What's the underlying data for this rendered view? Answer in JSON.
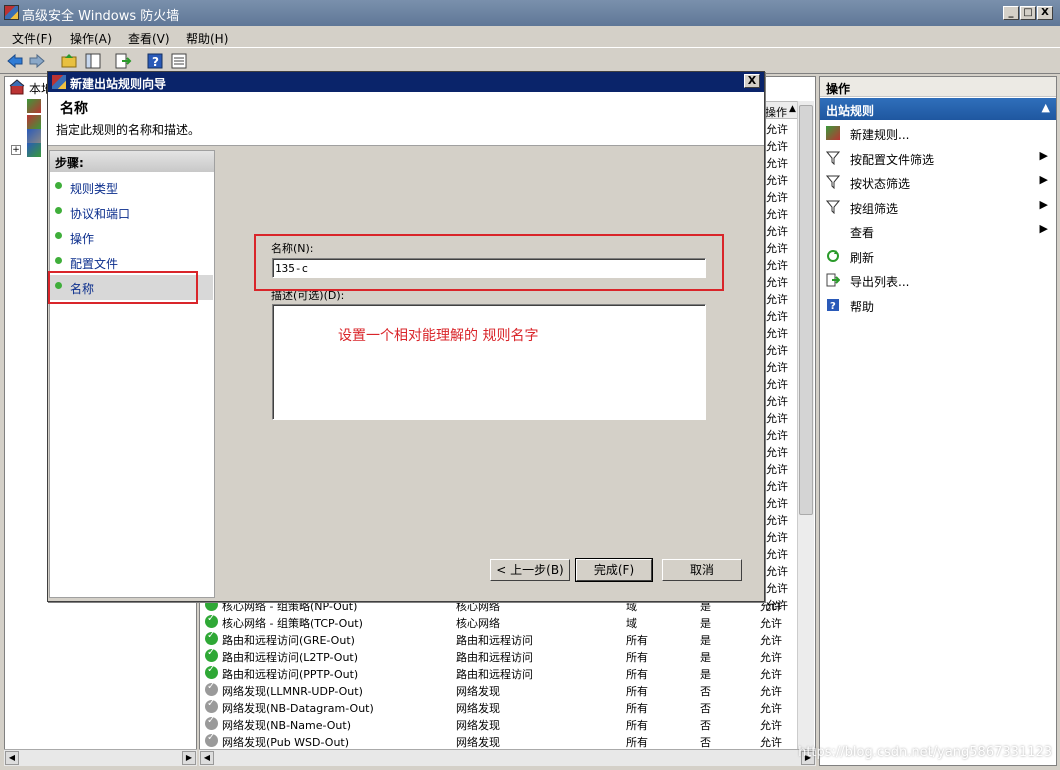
{
  "window": {
    "title": "高级安全 Windows 防火墙",
    "btn_min": "_",
    "btn_max": "□",
    "btn_close": "X"
  },
  "menu": [
    "文件(F)",
    "操作(A)",
    "查看(V)",
    "帮助(H)"
  ],
  "tree": {
    "root": "本地",
    "expand": "+"
  },
  "list": {
    "header_action": "操作",
    "partial_value": "允许",
    "rows": [
      {
        "name": "核心网络 - 组策略(NP-Out)",
        "group": "核心网络",
        "profile": "域",
        "enabled": "是",
        "action": "允许",
        "on": true
      },
      {
        "name": "核心网络 - 组策略(TCP-Out)",
        "group": "核心网络",
        "profile": "域",
        "enabled": "是",
        "action": "允许",
        "on": true
      },
      {
        "name": "路由和远程访问(GRE-Out)",
        "group": "路由和远程访问",
        "profile": "所有",
        "enabled": "是",
        "action": "允许",
        "on": true
      },
      {
        "name": "路由和远程访问(L2TP-Out)",
        "group": "路由和远程访问",
        "profile": "所有",
        "enabled": "是",
        "action": "允许",
        "on": true
      },
      {
        "name": "路由和远程访问(PPTP-Out)",
        "group": "路由和远程访问",
        "profile": "所有",
        "enabled": "是",
        "action": "允许",
        "on": true
      },
      {
        "name": "网络发现(LLMNR-UDP-Out)",
        "group": "网络发现",
        "profile": "所有",
        "enabled": "否",
        "action": "允许",
        "on": false
      },
      {
        "name": "网络发现(NB-Datagram-Out)",
        "group": "网络发现",
        "profile": "所有",
        "enabled": "否",
        "action": "允许",
        "on": false
      },
      {
        "name": "网络发现(NB-Name-Out)",
        "group": "网络发现",
        "profile": "所有",
        "enabled": "否",
        "action": "允许",
        "on": false
      },
      {
        "name": "网络发现(Pub WSD-Out)",
        "group": "网络发现",
        "profile": "所有",
        "enabled": "否",
        "action": "允许",
        "on": false
      }
    ]
  },
  "actions": {
    "header": "操作",
    "section": "出站规则",
    "items": [
      {
        "label": "新建规则...",
        "icon": "new-rule-icon",
        "sub": false
      },
      {
        "label": "按配置文件筛选",
        "icon": "filter-icon",
        "sub": true
      },
      {
        "label": "按状态筛选",
        "icon": "filter-icon",
        "sub": true
      },
      {
        "label": "按组筛选",
        "icon": "filter-icon",
        "sub": true
      },
      {
        "label": "查看",
        "icon": "",
        "sub": true
      },
      {
        "label": "刷新",
        "icon": "refresh-icon",
        "sub": false
      },
      {
        "label": "导出列表...",
        "icon": "export-icon",
        "sub": false
      },
      {
        "label": "帮助",
        "icon": "help-icon",
        "sub": false
      }
    ]
  },
  "dialog": {
    "title": "新建出站规则向导",
    "close": "X",
    "heading": "名称",
    "subtitle": "指定此规则的名称和描述。",
    "steps_header": "步骤:",
    "steps": [
      "规则类型",
      "协议和端口",
      "操作",
      "配置文件",
      "名称"
    ],
    "name_label": "名称(N):",
    "name_value": "135-c",
    "desc_label": "描述(可选)(D):",
    "annotation": "设置一个相对能理解的 规则名字",
    "btn_back": "< 上一步(B)",
    "btn_finish": "完成(F)",
    "btn_cancel": "取消"
  },
  "watermark": "https://blog.csdn.net/yang5867331123",
  "colors": {
    "accent": "#0a246a",
    "annotation": "#d9252a",
    "enabled": "#2fa836"
  }
}
